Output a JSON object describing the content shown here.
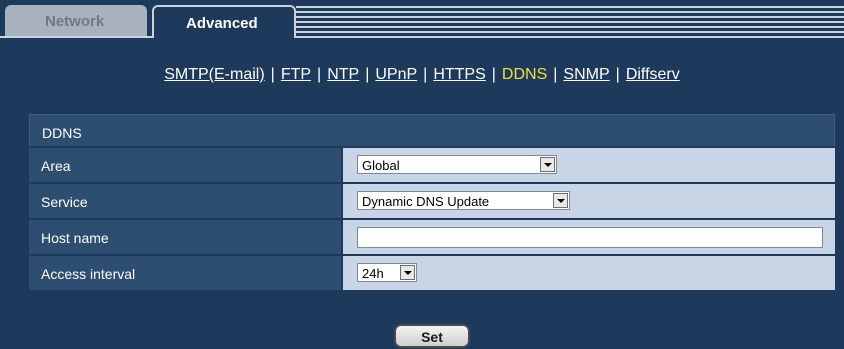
{
  "tabs": {
    "network": "Network",
    "advanced": "Advanced"
  },
  "subnav": {
    "items": [
      "SMTP(E-mail)",
      "FTP",
      "NTP",
      "UPnP",
      "HTTPS",
      "DDNS",
      "SNMP",
      "Diffserv"
    ],
    "separator": "|",
    "active": "DDNS"
  },
  "ddns": {
    "header": "DDNS",
    "area": {
      "label": "Area",
      "value": "Global"
    },
    "service": {
      "label": "Service",
      "value": "Dynamic DNS Update"
    },
    "host_name": {
      "label": "Host name",
      "value": ""
    },
    "access_interval": {
      "label": "Access interval",
      "value": "24h"
    }
  },
  "set_button": "Set",
  "colors": {
    "background": "#1d3a5c",
    "active_link": "#f0e040",
    "value_cell": "#c8d5e6"
  }
}
